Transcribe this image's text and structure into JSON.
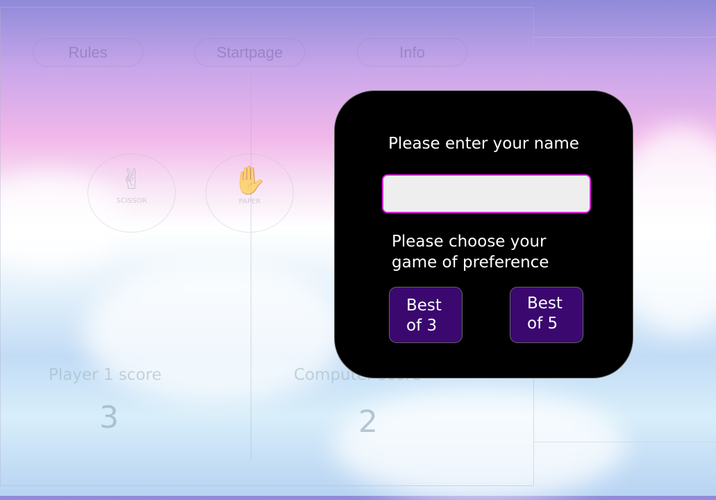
{
  "nav": {
    "rules": "Rules",
    "startpage": "Startpage",
    "info": "Info"
  },
  "choices": [
    {
      "label": "SCISSOR",
      "icon": "✌"
    },
    {
      "label": "PAPER",
      "icon": "✋"
    }
  ],
  "scores": {
    "player_label": "Player 1 score",
    "player_value": "3",
    "computer_label": "Computer score",
    "computer_value": "2"
  },
  "modal": {
    "title": "Please enter your name",
    "name_value": "",
    "prompt_line1": "Please choose your",
    "prompt_line2": "game of preference",
    "best3": "Best of 3",
    "best5": "Best of 5"
  }
}
